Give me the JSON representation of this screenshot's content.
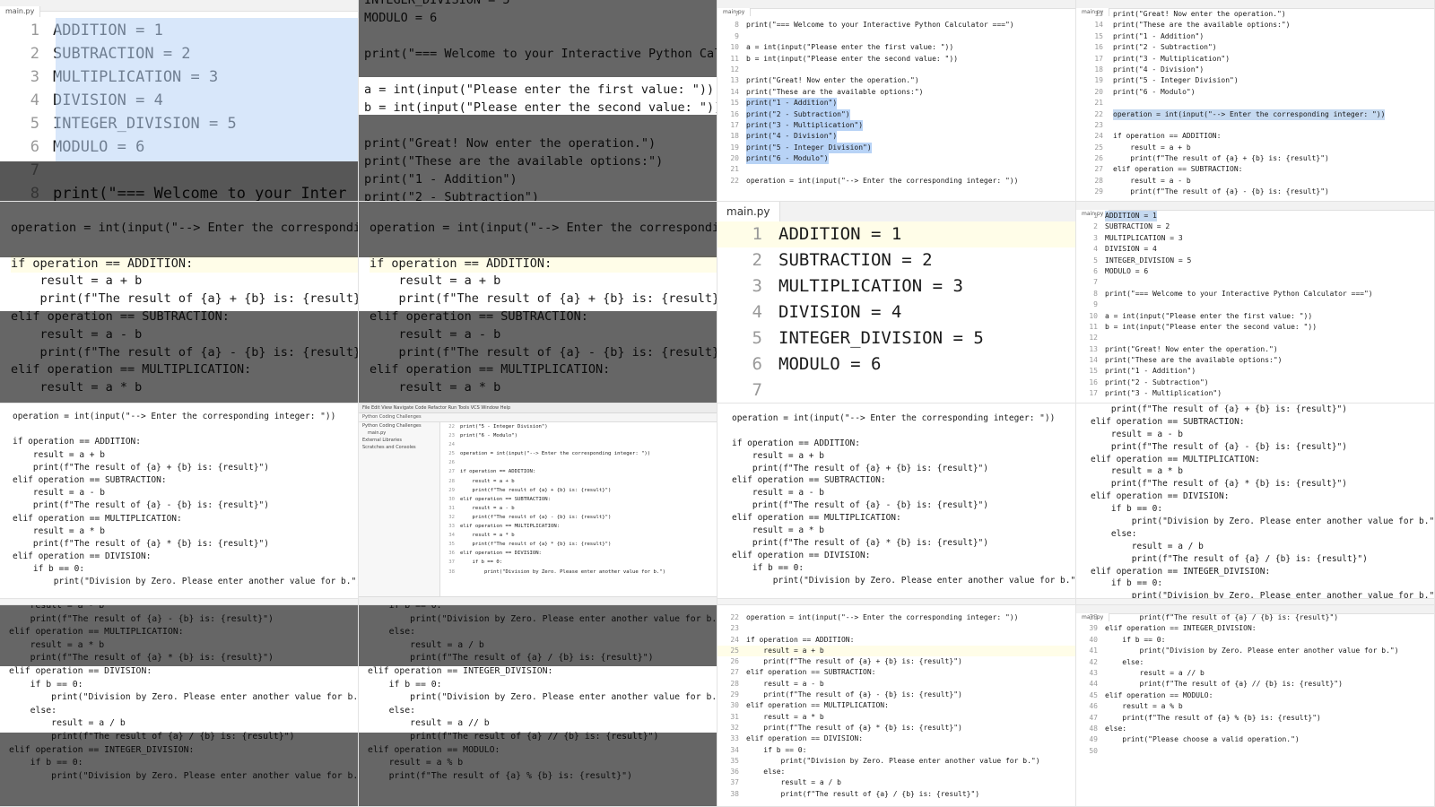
{
  "tabs": {
    "main_py": "main.py",
    "main_py_small": "main.py"
  },
  "tiles": {
    "t1": [
      {
        "n": "1",
        "t": "ADDITION = 1"
      },
      {
        "n": "2",
        "t": "SUBTRACTION = 2"
      },
      {
        "n": "3",
        "t": "MULTIPLICATION = 3"
      },
      {
        "n": "4",
        "t": "DIVISION = 4"
      },
      {
        "n": "5",
        "t": "INTEGER_DIVISION = 5"
      },
      {
        "n": "6",
        "t": "MODULO = 6"
      },
      {
        "n": "7",
        "t": ""
      },
      {
        "n": "8",
        "t": "print(\"=== Welcome to your Inter"
      }
    ],
    "t2_top": [
      {
        "t": "INTEGER_DIVISION = 5"
      },
      {
        "t": "MODULO = 6"
      },
      {
        "t": ""
      },
      {
        "t": "print(\"=== Welcome to your Interactive Python Calc"
      },
      {
        "t": ""
      },
      {
        "t": "a = int(input(\"Please enter the first value: \"))"
      },
      {
        "t": "b = int(input(\"Please enter the second value: \"))"
      },
      {
        "t": ""
      },
      {
        "t": "print(\"Great! Now enter the operation.\")"
      },
      {
        "t": "print(\"These are the available options:\")"
      },
      {
        "t": "print(\"1 - Addition\")"
      },
      {
        "t": "print(\"2 - Subtraction\")"
      }
    ],
    "t1_bottom": [
      {
        "t": "operation = int(input(\"--> Enter the corresponding"
      },
      {
        "t": ""
      },
      {
        "t": "if operation == ADDITION:"
      },
      {
        "t": "    result = a + b"
      },
      {
        "t": "    print(f\"The result of {a} + {b} is: {result}\")"
      },
      {
        "t": "elif operation == SUBTRACTION:"
      },
      {
        "t": "    result = a - b"
      },
      {
        "t": "    print(f\"The result of {a} - {b} is: {result}\")"
      },
      {
        "t": "elif operation == MULTIPLICATION:"
      },
      {
        "t": "    result = a * b"
      }
    ],
    "t2_bottom": [
      {
        "t": "operation = int(input(\"--> Enter the corresponding"
      },
      {
        "t": ""
      },
      {
        "t": "if operation == ADDITION:"
      },
      {
        "t": "    result = a + b"
      },
      {
        "t": "    print(f\"The result of {a} + {b} is: {result}\")"
      },
      {
        "t": "elif operation == SUBTRACTION:"
      },
      {
        "t": "    result = a - b"
      },
      {
        "t": "    print(f\"The result of {a} - {b} is: {result}\")"
      },
      {
        "t": "elif operation == MULTIPLICATION:"
      },
      {
        "t": "    result = a * b"
      }
    ],
    "t3": [
      {
        "n": "7",
        "t": ""
      },
      {
        "n": "8",
        "t": "print(\"=== Welcome to your Interactive Python Calculator ===\")"
      },
      {
        "n": "9",
        "t": ""
      },
      {
        "n": "10",
        "t": "a = int(input(\"Please enter the first value: \"))"
      },
      {
        "n": "11",
        "t": "b = int(input(\"Please enter the second value: \"))"
      },
      {
        "n": "12",
        "t": ""
      },
      {
        "n": "13",
        "t": "print(\"Great! Now enter the operation.\")"
      },
      {
        "n": "14",
        "t": "print(\"These are the available options:\")"
      },
      {
        "n": "15",
        "t": "print(\"1 - Addition\")"
      },
      {
        "n": "16",
        "t": "print(\"2 - Subtraction\")"
      },
      {
        "n": "17",
        "t": "print(\"3 - Multiplication\")"
      },
      {
        "n": "18",
        "t": "print(\"4 - Division\")"
      },
      {
        "n": "19",
        "t": "print(\"5 - Integer Division\")"
      },
      {
        "n": "20",
        "t": "print(\"6 - Modulo\")"
      },
      {
        "n": "21",
        "t": ""
      },
      {
        "n": "22",
        "t": "operation = int(input(\"--> Enter the corresponding integer: \"))"
      }
    ],
    "t4": [
      {
        "n": "13",
        "t": "print(\"Great! Now enter the operation.\")"
      },
      {
        "n": "14",
        "t": "print(\"These are the available options:\")"
      },
      {
        "n": "15",
        "t": "print(\"1 - Addition\")"
      },
      {
        "n": "16",
        "t": "print(\"2 - Subtraction\")"
      },
      {
        "n": "17",
        "t": "print(\"3 - Multiplication\")"
      },
      {
        "n": "18",
        "t": "print(\"4 - Division\")"
      },
      {
        "n": "19",
        "t": "print(\"5 - Integer Division\")"
      },
      {
        "n": "20",
        "t": "print(\"6 - Modulo\")"
      },
      {
        "n": "21",
        "t": ""
      },
      {
        "n": "22",
        "t": "operation = int(input(\"--> Enter the corresponding integer: \"))"
      },
      {
        "n": "23",
        "t": ""
      },
      {
        "n": "24",
        "t": "if operation == ADDITION:"
      },
      {
        "n": "25",
        "t": "    result = a + b"
      },
      {
        "n": "26",
        "t": "    print(f\"The result of {a} + {b} is: {result}\")"
      },
      {
        "n": "27",
        "t": "elif operation == SUBTRACTION:"
      },
      {
        "n": "28",
        "t": "    result = a - b"
      },
      {
        "n": "29",
        "t": "    print(f\"The result of {a} - {b} is: {result}\")"
      }
    ],
    "t7": [
      {
        "n": "1",
        "t": "ADDITION = 1"
      },
      {
        "n": "2",
        "t": "SUBTRACTION = 2"
      },
      {
        "n": "3",
        "t": "MULTIPLICATION = 3"
      },
      {
        "n": "4",
        "t": "DIVISION = 4"
      },
      {
        "n": "5",
        "t": "INTEGER_DIVISION = 5"
      },
      {
        "n": "6",
        "t": "MODULO = 6"
      },
      {
        "n": "7",
        "t": ""
      }
    ],
    "t8": [
      {
        "n": "1",
        "t": "ADDITION = 1"
      },
      {
        "n": "2",
        "t": "SUBTRACTION = 2"
      },
      {
        "n": "3",
        "t": "MULTIPLICATION = 3"
      },
      {
        "n": "4",
        "t": "DIVISION = 4"
      },
      {
        "n": "5",
        "t": "INTEGER_DIVISION = 5"
      },
      {
        "n": "6",
        "t": "MODULO = 6"
      },
      {
        "n": "7",
        "t": ""
      },
      {
        "n": "8",
        "t": "print(\"=== Welcome to your Interactive Python Calculator ===\")"
      },
      {
        "n": "9",
        "t": ""
      },
      {
        "n": "10",
        "t": "a = int(input(\"Please enter the first value: \"))"
      },
      {
        "n": "11",
        "t": "b = int(input(\"Please enter the second value: \"))"
      },
      {
        "n": "12",
        "t": ""
      },
      {
        "n": "13",
        "t": "print(\"Great! Now enter the operation.\")"
      },
      {
        "n": "14",
        "t": "print(\"These are the available options:\")"
      },
      {
        "n": "15",
        "t": "print(\"1 - Addition\")"
      },
      {
        "n": "16",
        "t": "print(\"2 - Subtraction\")"
      },
      {
        "n": "17",
        "t": "print(\"3 - Multiplication\")"
      }
    ],
    "t9": [
      {
        "t": "operation = int(input(\"--> Enter the corresponding integer: \"))"
      },
      {
        "t": ""
      },
      {
        "t": "if operation == ADDITION:"
      },
      {
        "t": "    result = a + b"
      },
      {
        "t": "    print(f\"The result of {a} + {b} is: {result}\")"
      },
      {
        "t": "elif operation == SUBTRACTION:"
      },
      {
        "t": "    result = a - b"
      },
      {
        "t": "    print(f\"The result of {a} - {b} is: {result}\")"
      },
      {
        "t": "elif operation == MULTIPLICATION:"
      },
      {
        "t": "    result = a * b"
      },
      {
        "t": "    print(f\"The result of {a} * {b} is: {result}\")"
      },
      {
        "t": "elif operation == DIVISION:"
      },
      {
        "t": "    if b == 0:"
      },
      {
        "t": "        print(\"Division by Zero. Please enter another value for b.\")"
      }
    ],
    "t10": [
      {
        "n": "22",
        "t": "print(\"5 - Integer Division\")"
      },
      {
        "n": "23",
        "t": "print(\"6 - Modulo\")"
      },
      {
        "n": "24",
        "t": ""
      },
      {
        "n": "25",
        "t": "operation = int(input(\"--> Enter the corresponding integer: \"))"
      },
      {
        "n": "26",
        "t": ""
      },
      {
        "n": "27",
        "t": "if operation == ADDITION:"
      },
      {
        "n": "28",
        "t": "    result = a + b"
      },
      {
        "n": "29",
        "t": "    print(f\"The result of {a} + {b} is: {result}\")"
      },
      {
        "n": "30",
        "t": "elif operation == SUBTRACTION:"
      },
      {
        "n": "31",
        "t": "    result = a - b"
      },
      {
        "n": "32",
        "t": "    print(f\"The result of {a} - {b} is: {result}\")"
      },
      {
        "n": "33",
        "t": "elif operation == MULTIPLICATION:"
      },
      {
        "n": "34",
        "t": "    result = a * b"
      },
      {
        "n": "35",
        "t": "    print(f\"The result of {a} * {b} is: {result}\")"
      },
      {
        "n": "36",
        "t": "elif operation == DIVISION:"
      },
      {
        "n": "37",
        "t": "    if b == 0:"
      },
      {
        "n": "38",
        "t": "        print(\"Division by Zero. Please enter another value for b.\")"
      }
    ],
    "t11": [
      {
        "t": "operation = int(input(\"--> Enter the corresponding integer: \"))"
      },
      {
        "t": ""
      },
      {
        "t": "if operation == ADDITION:"
      },
      {
        "t": "    result = a + b"
      },
      {
        "t": "    print(f\"The result of {a} + {b} is: {result}\")"
      },
      {
        "t": "elif operation == SUBTRACTION:"
      },
      {
        "t": "    result = a - b"
      },
      {
        "t": "    print(f\"The result of {a} - {b} is: {result}\")"
      },
      {
        "t": "elif operation == MULTIPLICATION:"
      },
      {
        "t": "    result = a * b"
      },
      {
        "t": "    print(f\"The result of {a} * {b} is: {result}\")"
      },
      {
        "t": "elif operation == DIVISION:"
      },
      {
        "t": "    if b == 0:"
      },
      {
        "t": "        print(\"Division by Zero. Please enter another value for b.\")"
      }
    ],
    "t12": [
      {
        "t": "    print(f\"The result of {a} + {b} is: {result}\")"
      },
      {
        "t": "elif operation == SUBTRACTION:"
      },
      {
        "t": "    result = a - b"
      },
      {
        "t": "    print(f\"The result of {a} - {b} is: {result}\")"
      },
      {
        "t": "elif operation == MULTIPLICATION:"
      },
      {
        "t": "    result = a * b"
      },
      {
        "t": "    print(f\"The result of {a} * {b} is: {result}\")"
      },
      {
        "t": "elif operation == DIVISION:"
      },
      {
        "t": "    if b == 0:"
      },
      {
        "t": "        print(\"Division by Zero. Please enter another value for b.\")"
      },
      {
        "t": "    else:"
      },
      {
        "t": "        result = a / b"
      },
      {
        "t": "        print(f\"The result of {a} / {b} is: {result}\")"
      },
      {
        "t": "elif operation == INTEGER_DIVISION:"
      },
      {
        "t": "    if b == 0:"
      },
      {
        "t": "        print(\"Division by Zero. Please enter another value for b.\")"
      }
    ],
    "t13": [
      {
        "t": "    result = a - b"
      },
      {
        "t": "    print(f\"The result of {a} - {b} is: {result}\")"
      },
      {
        "t": "elif operation == MULTIPLICATION:"
      },
      {
        "t": "    result = a * b"
      },
      {
        "t": "    print(f\"The result of {a} * {b} is: {result}\")"
      },
      {
        "t": "elif operation == DIVISION:"
      },
      {
        "t": "    if b == 0:"
      },
      {
        "t": "        print(\"Division by Zero. Please enter another value for b.\")"
      },
      {
        "t": "    else:"
      },
      {
        "t": "        result = a / b"
      },
      {
        "t": "        print(f\"The result of {a} / {b} is: {result}\")"
      },
      {
        "t": "elif operation == INTEGER_DIVISION:"
      },
      {
        "t": "    if b == 0:"
      },
      {
        "t": "        print(\"Division by Zero. Please enter another value for b.\")"
      }
    ],
    "t14": [
      {
        "t": "    if b == 0:"
      },
      {
        "t": "        print(\"Division by Zero. Please enter another value for b.\")"
      },
      {
        "t": "    else:"
      },
      {
        "t": "        result = a / b"
      },
      {
        "t": "        print(f\"The result of {a} / {b} is: {result}\")"
      },
      {
        "t": "elif operation == INTEGER_DIVISION:"
      },
      {
        "t": "    if b == 0:"
      },
      {
        "t": "        print(\"Division by Zero. Please enter another value for b.\")"
      },
      {
        "t": "    else:"
      },
      {
        "t": "        result = a // b"
      },
      {
        "t": "        print(f\"The result of {a} // {b} is: {result}\")"
      },
      {
        "t": "elif operation == MODULO:"
      },
      {
        "t": "    result = a % b"
      },
      {
        "t": "    print(f\"The result of {a} % {b} is: {result}\")"
      }
    ],
    "t15": [
      {
        "n": "22",
        "t": "operation = int(input(\"--> Enter the corresponding integer: \"))"
      },
      {
        "n": "23",
        "t": ""
      },
      {
        "n": "24",
        "t": "if operation == ADDITION:"
      },
      {
        "n": "25",
        "t": "    result = a + b"
      },
      {
        "n": "26",
        "t": "    print(f\"The result of {a} + {b} is: {result}\")"
      },
      {
        "n": "27",
        "t": "elif operation == SUBTRACTION:"
      },
      {
        "n": "28",
        "t": "    result = a - b"
      },
      {
        "n": "29",
        "t": "    print(f\"The result of {a} - {b} is: {result}\")"
      },
      {
        "n": "30",
        "t": "elif operation == MULTIPLICATION:"
      },
      {
        "n": "31",
        "t": "    result = a * b"
      },
      {
        "n": "32",
        "t": "    print(f\"The result of {a} * {b} is: {result}\")"
      },
      {
        "n": "33",
        "t": "elif operation == DIVISION:"
      },
      {
        "n": "34",
        "t": "    if b == 0:"
      },
      {
        "n": "35",
        "t": "        print(\"Division by Zero. Please enter another value for b.\")"
      },
      {
        "n": "36",
        "t": "    else:"
      },
      {
        "n": "37",
        "t": "        result = a / b"
      },
      {
        "n": "38",
        "t": "        print(f\"The result of {a} / {b} is: {result}\")"
      }
    ],
    "t16": [
      {
        "n": "38",
        "t": "        print(f\"The result of {a} / {b} is: {result}\")"
      },
      {
        "n": "39",
        "t": "elif operation == INTEGER_DIVISION:"
      },
      {
        "n": "40",
        "t": "    if b == 0:"
      },
      {
        "n": "41",
        "t": "        print(\"Division by Zero. Please enter another value for b.\")"
      },
      {
        "n": "42",
        "t": "    else:"
      },
      {
        "n": "43",
        "t": "        result = a // b"
      },
      {
        "n": "44",
        "t": "        print(f\"The result of {a} // {b} is: {result}\")"
      },
      {
        "n": "45",
        "t": "elif operation == MODULO:"
      },
      {
        "n": "46",
        "t": "    result = a % b"
      },
      {
        "n": "47",
        "t": "    print(f\"The result of {a} % {b} is: {result}\")"
      },
      {
        "n": "48",
        "t": "else:"
      },
      {
        "n": "49",
        "t": "    print(\"Please choose a valid operation.\")"
      },
      {
        "n": "50",
        "t": ""
      }
    ]
  },
  "ide": {
    "project_title": "Python Coding Challenges",
    "tree": [
      "Python Coding Challenges",
      "main.py",
      "External Libraries",
      "Scratches and Consoles"
    ]
  },
  "colors": {
    "selection": "#b8d3f6",
    "number": "#1750eb",
    "caret_line": "#fffde8",
    "dim_overlay": "#000000"
  }
}
